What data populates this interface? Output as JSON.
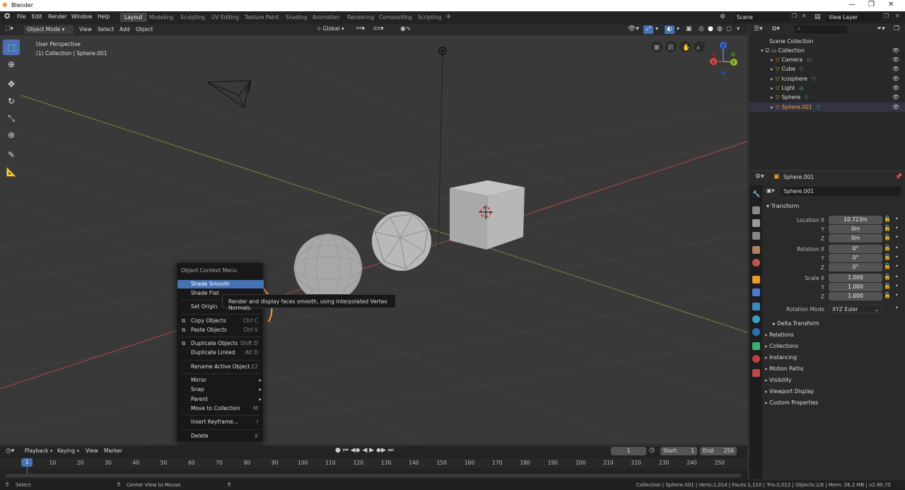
{
  "window": {
    "title": "Blender"
  },
  "menu": [
    "File",
    "Edit",
    "Render",
    "Window",
    "Help"
  ],
  "workspaces": [
    {
      "label": "Layout",
      "active": true
    },
    {
      "label": "Modeling"
    },
    {
      "label": "Sculpting"
    },
    {
      "label": "UV Editing"
    },
    {
      "label": "Texture Paint"
    },
    {
      "label": "Shading"
    },
    {
      "label": "Animation"
    },
    {
      "label": "Rendering"
    },
    {
      "label": "Compositing"
    },
    {
      "label": "Scripting"
    }
  ],
  "scene": {
    "label": "Scene"
  },
  "view_layer": {
    "label": "View Layer"
  },
  "viewport_header": {
    "mode": "Object Mode",
    "menus": [
      "View",
      "Select",
      "Add",
      "Object"
    ],
    "orientation": "Global"
  },
  "viewport": {
    "perspective": "User Perspective",
    "context": "(1) Collection | Sphere.001"
  },
  "context_menu": {
    "title": "Object Context Menu",
    "items": [
      {
        "label": "Shade Smooth",
        "shortcut": "",
        "hl": true
      },
      {
        "label": "Shade Flat",
        "shortcut": ""
      },
      {
        "label": "Set Origin",
        "shortcut": "",
        "sub": true
      },
      {
        "label": "Copy Objects",
        "shortcut": "Ctrl C"
      },
      {
        "label": "Paste Objects",
        "shortcut": "Ctrl V"
      },
      {
        "label": "Duplicate Objects",
        "shortcut": "Shift D"
      },
      {
        "label": "Duplicate Linked",
        "shortcut": "Alt D"
      },
      {
        "label": "Rename Active Object...",
        "shortcut": "F2"
      },
      {
        "label": "Mirror",
        "shortcut": "",
        "sub": true
      },
      {
        "label": "Snap",
        "shortcut": "",
        "sub": true
      },
      {
        "label": "Parent",
        "shortcut": "",
        "sub": true
      },
      {
        "label": "Move to Collection",
        "shortcut": "M"
      },
      {
        "label": "Insert Keyframe...",
        "shortcut": "I"
      },
      {
        "label": "Delete",
        "shortcut": "X"
      }
    ]
  },
  "tooltip": "Render and display faces smooth, using interpolated Vertex Normals.",
  "outliner": {
    "root": "Scene Collection",
    "collection": "Collection",
    "objects": [
      {
        "name": "Camera",
        "active": false
      },
      {
        "name": "Cube",
        "active": false
      },
      {
        "name": "Icosphere",
        "active": false
      },
      {
        "name": "Light",
        "active": false
      },
      {
        "name": "Sphere",
        "active": false
      },
      {
        "name": "Sphere.001",
        "active": true
      }
    ]
  },
  "properties": {
    "object_name": "Sphere.001",
    "transform_label": "Transform",
    "location": {
      "label": "Location X",
      "x": "10.723m",
      "y": "0m",
      "z": "0m"
    },
    "rotation": {
      "label": "Rotation X",
      "x": "0°",
      "y": "0°",
      "z": "0°"
    },
    "scale": {
      "label": "Scale X",
      "x": "1.000",
      "y": "1.000",
      "z": "1.000"
    },
    "axis_y": "Y",
    "axis_z": "Z",
    "rotation_mode_label": "Rotation Mode",
    "rotation_mode": "XYZ Euler",
    "delta_transform": "Delta Transform",
    "sections": [
      "Relations",
      "Collections",
      "Instancing",
      "Motion Paths",
      "Visibility",
      "Viewport Display",
      "Custom Properties"
    ]
  },
  "timeline": {
    "menus": [
      "Playback",
      "Keying",
      "View",
      "Marker"
    ],
    "current_frame": "1",
    "start_label": "Start:",
    "start": "1",
    "end_label": "End:",
    "end": "250",
    "ticks": [
      "1",
      "10",
      "20",
      "30",
      "40",
      "50",
      "60",
      "70",
      "80",
      "90",
      "100",
      "110",
      "120",
      "130",
      "140",
      "150",
      "160",
      "170",
      "180",
      "190",
      "200",
      "210",
      "220",
      "230",
      "240",
      "250"
    ]
  },
  "status": {
    "left": "Select",
    "middle": "Center View to Mouse",
    "right": "Collection | Sphere.001 | Verts:1,014 | Faces:1,110 | Tris:2,012 | Objects:1/6 | Mem: 26.2 MB | v2.80.75"
  },
  "colors": {
    "accent": "#4772b3",
    "active_object": "#f0a040",
    "x_axis": "#c94040",
    "y_axis": "#8aa840"
  }
}
